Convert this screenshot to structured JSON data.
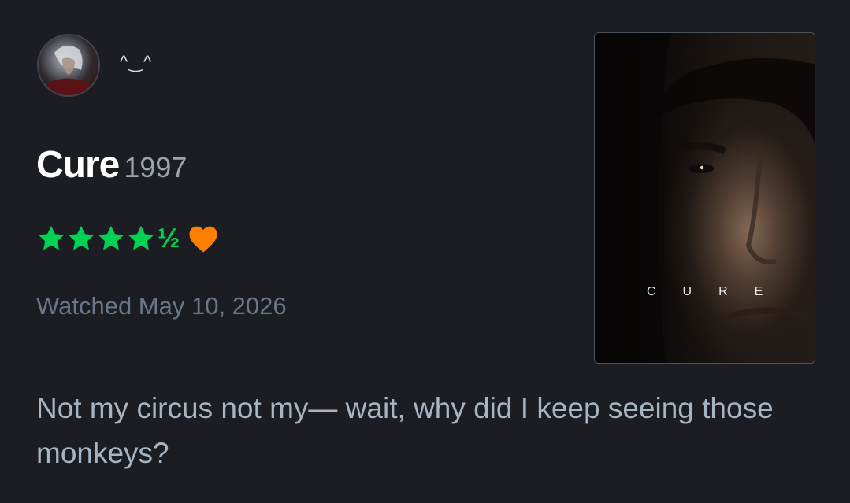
{
  "user": {
    "avatar_icon": "user-avatar-silver-hair",
    "username": "^‿^"
  },
  "film": {
    "title": "Cure",
    "year": "1997",
    "poster_title": "CURE"
  },
  "rating": {
    "stars": 4.5,
    "max_stars": 5,
    "half_glyph": "½",
    "star_color": "#00d254",
    "liked": true,
    "heart_color": "#ff8000"
  },
  "watched": {
    "label": "Watched May 10, 2026"
  },
  "review": {
    "text": "Not my circus not my— wait, why did I keep seeing those monkeys?"
  },
  "colors": {
    "background": "#1b1d23",
    "title": "#ffffff",
    "year": "#9aa3ae",
    "muted": "#6b7686",
    "review_text": "#a7b4c2"
  }
}
